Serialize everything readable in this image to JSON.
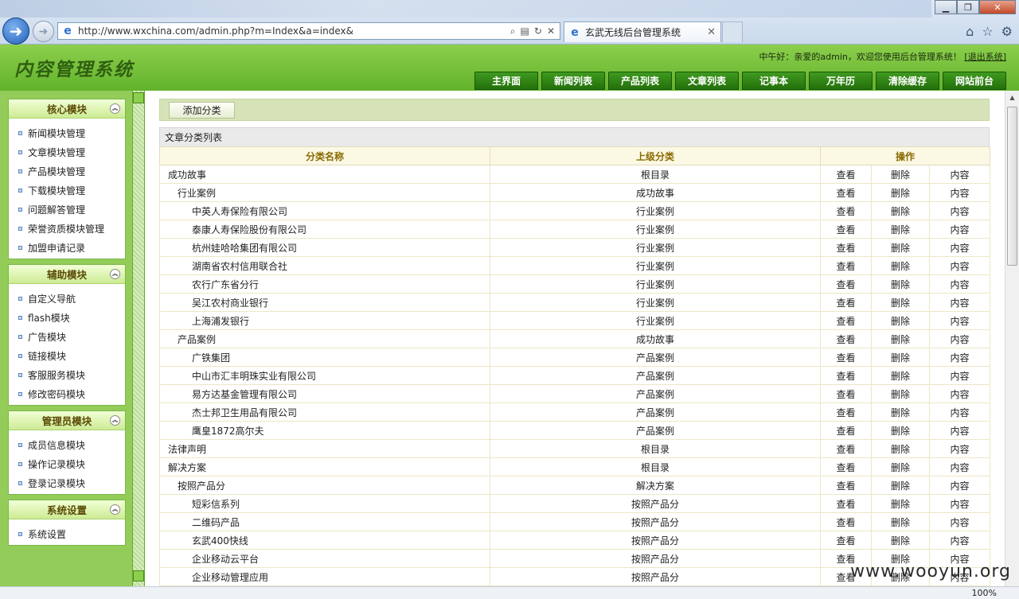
{
  "browser": {
    "url": "http://www.wxchina.com/admin.php?m=Index&a=index&",
    "tab_title": "玄武无线后台管理系统",
    "zoom": "100%",
    "watermark": "www.wooyun.org"
  },
  "header": {
    "logo": "内容管理系统",
    "greeting": "中午好：亲爱的admin，欢迎您使用后台管理系统！",
    "logout": "[退出系统]",
    "nav": [
      "主界面",
      "新闻列表",
      "产品列表",
      "文章列表",
      "记事本",
      "万年历",
      "清除缓存",
      "网站前台"
    ]
  },
  "sidebar": {
    "groups": [
      {
        "title": "核心模块",
        "items": [
          "新闻模块管理",
          "文章模块管理",
          "产品模块管理",
          "下载模块管理",
          "问题解答管理",
          "荣誉资质模块管理",
          "加盟申请记录"
        ]
      },
      {
        "title": "辅助模块",
        "items": [
          "自定义导航",
          "flash模块",
          "广告模块",
          "链接模块",
          "客服服务模块",
          "修改密码模块"
        ]
      },
      {
        "title": "管理员模块",
        "items": [
          "成员信息模块",
          "操作记录模块",
          "登录记录模块"
        ]
      },
      {
        "title": "系统设置",
        "items": [
          "系统设置"
        ]
      }
    ]
  },
  "main": {
    "add_button": "添加分类",
    "list_title": "文章分类列表",
    "columns": [
      "分类名称",
      "上级分类",
      "操作"
    ],
    "actions": [
      "查看",
      "删除",
      "内容"
    ],
    "rows": [
      {
        "name": "成功故事",
        "parent": "根目录",
        "level": 0
      },
      {
        "name": "行业案例",
        "parent": "成功故事",
        "level": 1
      },
      {
        "name": "中英人寿保险有限公司",
        "parent": "行业案例",
        "level": 2
      },
      {
        "name": "泰康人寿保险股份有限公司",
        "parent": "行业案例",
        "level": 2
      },
      {
        "name": "杭州娃哈哈集团有限公司",
        "parent": "行业案例",
        "level": 2
      },
      {
        "name": "湖南省农村信用联合社",
        "parent": "行业案例",
        "level": 2
      },
      {
        "name": "农行广东省分行",
        "parent": "行业案例",
        "level": 2
      },
      {
        "name": "吴江农村商业银行",
        "parent": "行业案例",
        "level": 2
      },
      {
        "name": "上海浦发银行",
        "parent": "行业案例",
        "level": 2
      },
      {
        "name": "产品案例",
        "parent": "成功故事",
        "level": 1
      },
      {
        "name": "广铁集团",
        "parent": "产品案例",
        "level": 2
      },
      {
        "name": "中山市汇丰明珠实业有限公司",
        "parent": "产品案例",
        "level": 2
      },
      {
        "name": "易方达基金管理有限公司",
        "parent": "产品案例",
        "level": 2
      },
      {
        "name": "杰士邦卫生用品有限公司",
        "parent": "产品案例",
        "level": 2
      },
      {
        "name": "鹰皇1872高尔夫",
        "parent": "产品案例",
        "level": 2
      },
      {
        "name": "法律声明",
        "parent": "根目录",
        "level": 0
      },
      {
        "name": "解决方案",
        "parent": "根目录",
        "level": 0
      },
      {
        "name": "按照产品分",
        "parent": "解决方案",
        "level": 1
      },
      {
        "name": "短彩信系列",
        "parent": "按照产品分",
        "level": 2
      },
      {
        "name": "二维码产品",
        "parent": "按照产品分",
        "level": 2
      },
      {
        "name": "玄武400快线",
        "parent": "按照产品分",
        "level": 2
      },
      {
        "name": "企业移动云平台",
        "parent": "按照产品分",
        "level": 2
      },
      {
        "name": "企业移动管理应用",
        "parent": "按照产品分",
        "level": 2
      }
    ]
  }
}
